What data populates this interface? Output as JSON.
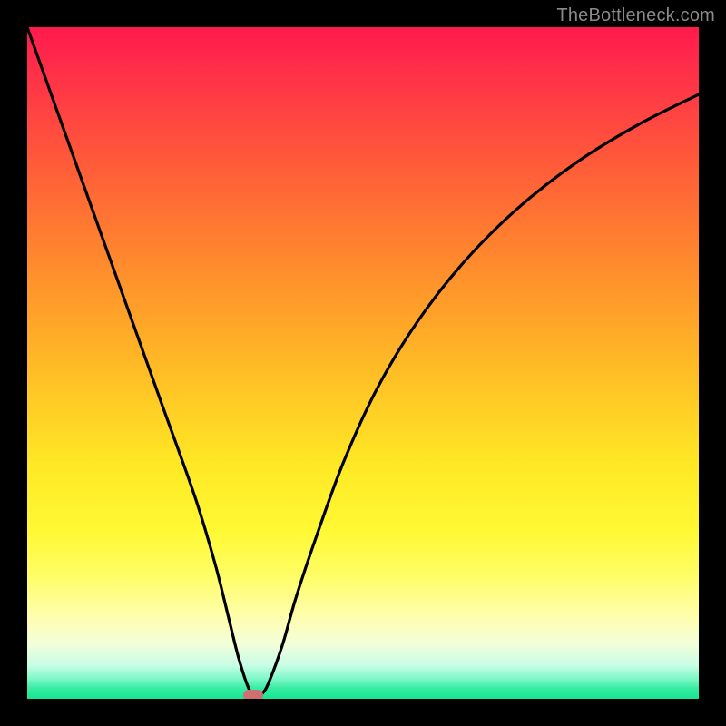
{
  "watermark": "TheBottleneck.com",
  "chart_data": {
    "type": "line",
    "title": "",
    "xlabel": "",
    "ylabel": "",
    "xlim": [
      0,
      100
    ],
    "ylim": [
      0,
      100
    ],
    "grid": false,
    "legend": false,
    "background": {
      "style": "vertical-gradient",
      "stops": [
        {
          "pos": 0.0,
          "color": "#ff1a4d"
        },
        {
          "pos": 0.25,
          "color": "#ff6a35"
        },
        {
          "pos": 0.5,
          "color": "#ffba26"
        },
        {
          "pos": 0.75,
          "color": "#fff933"
        },
        {
          "pos": 0.92,
          "color": "#f1feda"
        },
        {
          "pos": 1.0,
          "color": "#16e692"
        }
      ]
    },
    "series": [
      {
        "name": "bottleneck-curve",
        "color": "#000000",
        "x": [
          0.0,
          5.0,
          10.0,
          15.0,
          20.0,
          25.0,
          28.0,
          30.0,
          31.5,
          33.0,
          34.0,
          35.0,
          36.0,
          38.0,
          40.0,
          43.0,
          47.0,
          52.0,
          58.0,
          65.0,
          73.0,
          82.0,
          91.0,
          100.0
        ],
        "y": [
          100.0,
          86.0,
          72.0,
          58.0,
          44.0,
          30.0,
          20.0,
          12.0,
          6.0,
          1.5,
          0.5,
          0.8,
          2.5,
          8.0,
          15.0,
          24.0,
          35.0,
          46.0,
          56.0,
          65.0,
          73.0,
          80.0,
          85.5,
          90.0
        ]
      }
    ],
    "marker": {
      "name": "optimal-point",
      "x": 33.7,
      "y": 0.6,
      "shape": "rounded-rect",
      "color": "#cf6f70"
    },
    "ticks": {
      "x": [],
      "y": []
    }
  }
}
